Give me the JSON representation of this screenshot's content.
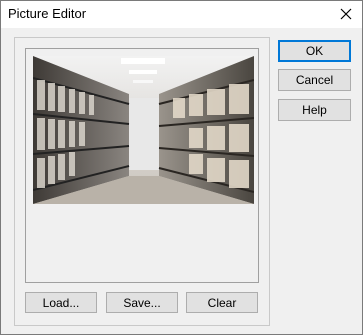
{
  "window": {
    "title": "Picture Editor"
  },
  "buttons": {
    "ok": "OK",
    "cancel": "Cancel",
    "help": "Help",
    "load": "Load...",
    "save": "Save...",
    "clear": "Clear"
  },
  "icons": {
    "close": "close-icon"
  },
  "colors": {
    "accent": "#0078d7",
    "dialog_bg": "#f0f0f0"
  }
}
